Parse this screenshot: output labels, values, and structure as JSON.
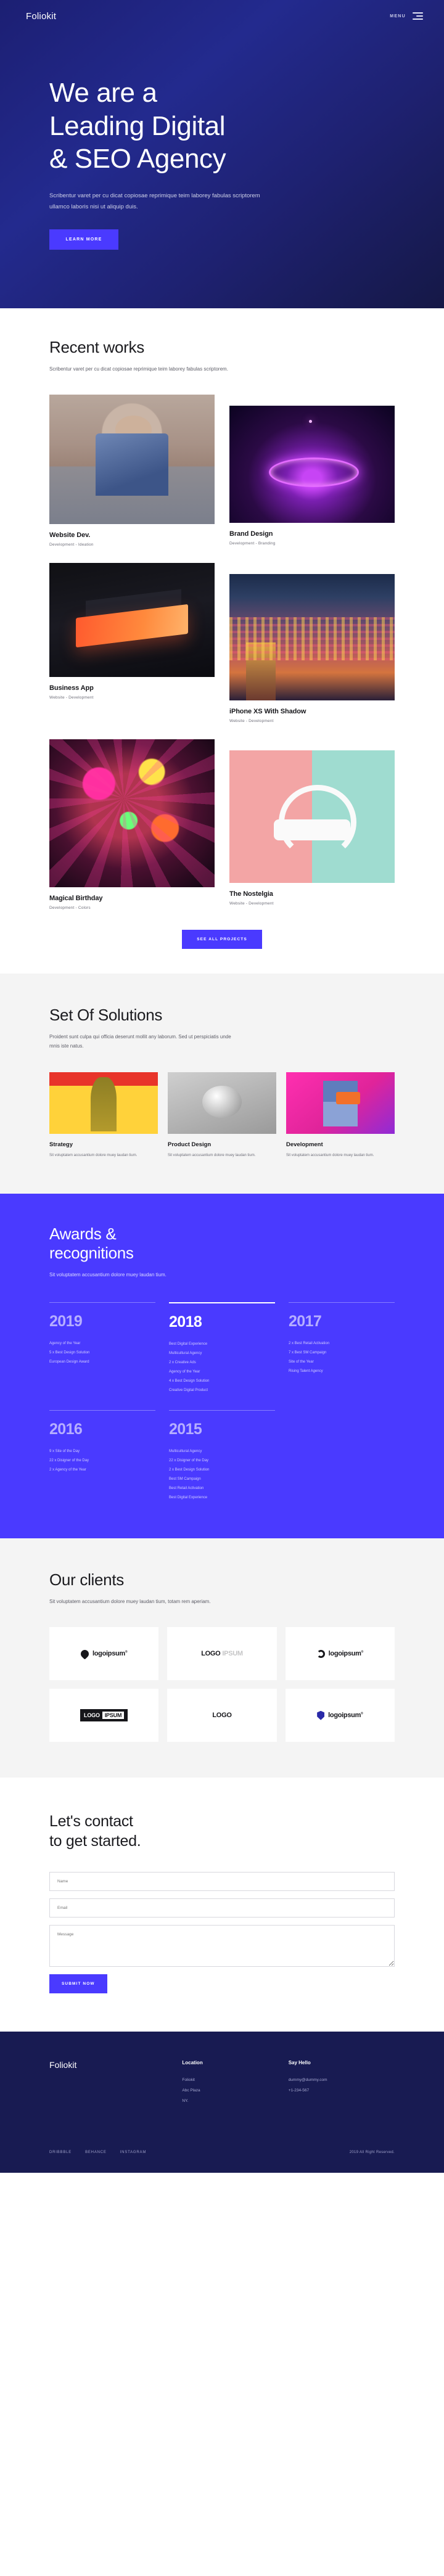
{
  "brand": {
    "name": "Foliokit",
    "accent": "#4a3aff",
    "hero_bg": "#1f2275",
    "footer_bg": "#181b52"
  },
  "nav": {
    "menu_label": "MENU",
    "menu_icon": "hamburger-icon"
  },
  "hero": {
    "heading_line1": "We are a",
    "heading_line2": "Leading Digital",
    "heading_line3": "& SEO Agency",
    "paragraph": "Scribentur varet per cu dicat copiosae reprimique teim laborey fabulas scriptorem ullamco laboris nisi ut aliquip duis.",
    "cta_label": "LEARN MORE"
  },
  "works": {
    "title": "Recent works",
    "subtitle": "Scribentur varet per cu dicat copiosae reprimique teim laborey fabulas scriptorem.",
    "cta_label": "SEE ALL PROJECTS",
    "items": [
      {
        "title": "Website Dev.",
        "category": "Development - Ideation",
        "art": "img-model"
      },
      {
        "title": "Brand Design",
        "category": "Development - Branding",
        "art": "img-neon"
      },
      {
        "title": "Business App",
        "category": "Website - Development",
        "art": "img-laptop"
      },
      {
        "title": "iPhone XS With Shadow",
        "category": "Website - Development",
        "art": "img-street"
      },
      {
        "title": "Magical Birthday",
        "category": "Development - Colors",
        "art": "img-paint"
      },
      {
        "title": "The Nostelgia",
        "category": "Website - Development",
        "art": "img-head"
      }
    ]
  },
  "solutions": {
    "title": "Set Of Solutions",
    "subtitle": "Proident sunt culpa qui officia deserunt mollit any laborum. Sed ut perspiciatis unde mnis iste natus.",
    "items": [
      {
        "title": "Strategy",
        "text": "Sit voluptatem accusantium dolore muey laudan tium.",
        "art": "th-strategy"
      },
      {
        "title": "Product Design",
        "text": "Sit voluptatem accusantium dolore muey laudan tium.",
        "art": "th-product"
      },
      {
        "title": "Development",
        "text": "Sit voluptatem accusantium dolore muey laudan tium.",
        "art": "th-dev"
      }
    ]
  },
  "awards": {
    "title_line1": "Awards &",
    "title_line2": "recognitions",
    "subtitle": "Sit voluptatem accusantium dolore muey laudan tium.",
    "columns": [
      {
        "year": "2019",
        "active": false,
        "items": [
          "Agency of the Year",
          "5 x Best Design Solution",
          "European Design Award"
        ]
      },
      {
        "year": "2018",
        "active": true,
        "items": [
          "Best Digital Experience",
          "Multicultural Agency",
          "2 x Creative Ads",
          "Agency of the Year",
          "4 x Best Design Solution",
          "Creative Digital Product"
        ]
      },
      {
        "year": "2017",
        "active": false,
        "items": [
          "2 x Best Retail Activation",
          "7 x Best SM Campaign",
          "Site of the Year",
          "Rising Talent Agency"
        ]
      },
      {
        "year": "2016",
        "active": false,
        "items": [
          "9 x Site of the Day",
          "22 x Disigner of the Day",
          "2 x Agency of the Year"
        ]
      },
      {
        "year": "2015",
        "active": false,
        "items": [
          "Multicultural Agency",
          "22 x Disigner of the Day",
          "2 x Best Design Solution",
          "Best SM Campaign",
          "Best Retail Activation",
          "Best Digital Experience"
        ]
      }
    ]
  },
  "clients": {
    "title": "Our clients",
    "subtitle": "Sit voluptatem accusantium dolore muey laudan tium, totam rem aperiam.",
    "logos": [
      {
        "style": "drop",
        "text": "logoipsum",
        "sup": "®"
      },
      {
        "style": "ring",
        "text": "LOGO",
        "sup": "IPSUM"
      },
      {
        "style": "burst",
        "text": "logoipsum",
        "sup": "®"
      },
      {
        "style": "box",
        "text": "LOGO",
        "sup": "IPSUM"
      },
      {
        "style": "stripe",
        "text": "LOGO",
        "sup": ""
      },
      {
        "style": "shield",
        "text": "logoipsum",
        "sup": "®"
      }
    ]
  },
  "contact": {
    "title_line1": "Let's contact",
    "title_line2": "to get started.",
    "name_placeholder": "Name",
    "email_placeholder": "Email",
    "message_placeholder": "Message",
    "submit_label": "SUBMIT NOW"
  },
  "footer": {
    "logo": "Foliokit",
    "location_title": "Location",
    "location_lines": [
      "Foliokit",
      "Abc Plaza",
      "NY."
    ],
    "contact_title": "Say Hello",
    "contact_lines": [
      "dummy@dummy.com",
      "+1-234-567"
    ],
    "socials": [
      "DRIBBBLE",
      "BEHANCE",
      "INSTAGRAM"
    ],
    "copyright": "2019 All Right Reserved."
  }
}
